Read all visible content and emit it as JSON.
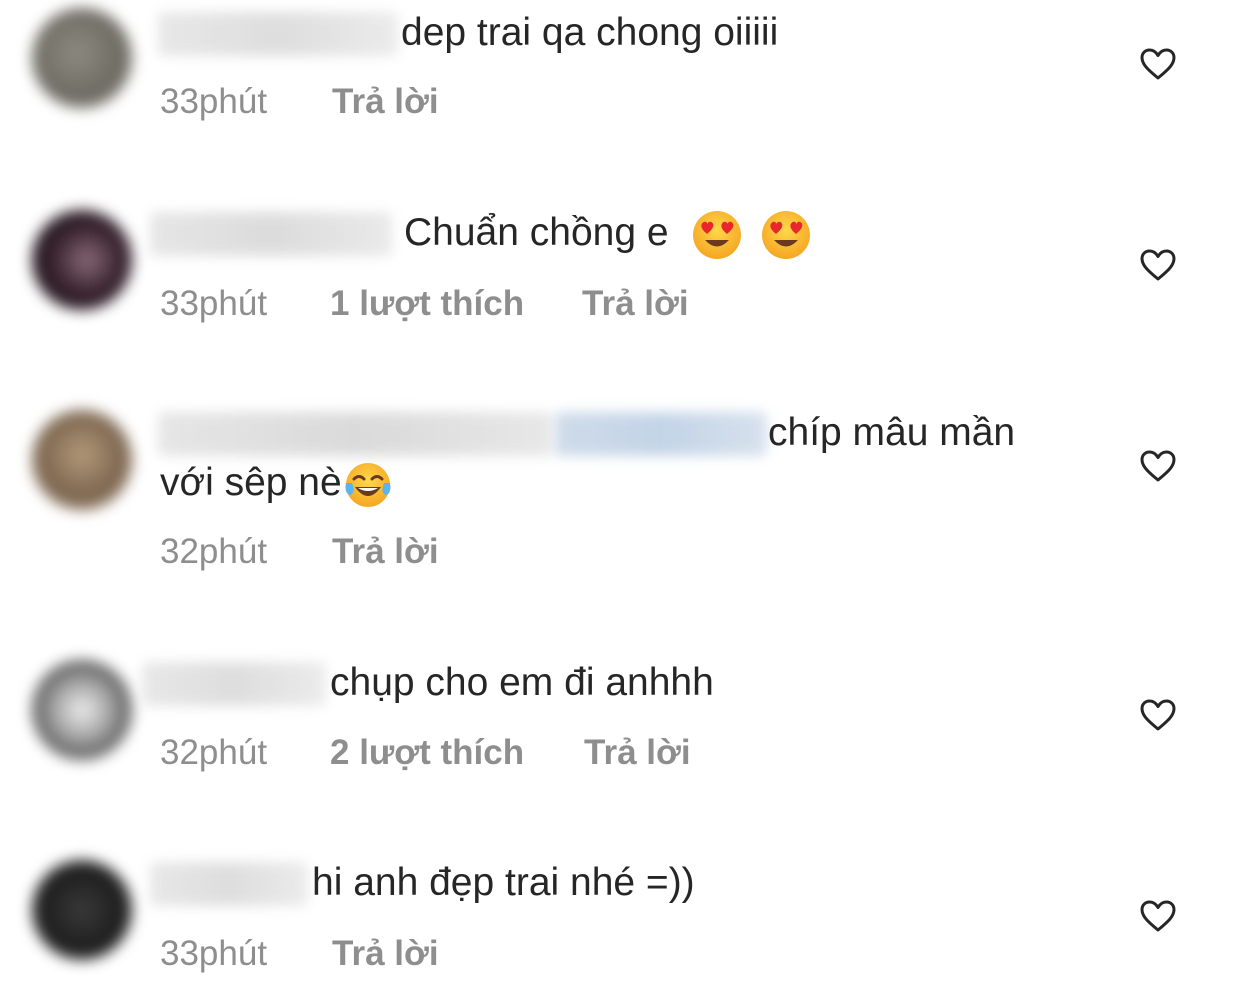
{
  "comments": [
    {
      "text": "dep trai qa chong oiiiii",
      "time": "33phút",
      "likes": "",
      "reply": "Trả lời"
    },
    {
      "text": "Chuẩn chồng e",
      "time": "33phút",
      "likes": "1 lượt thích",
      "reply": "Trả lời",
      "emojis": [
        "heart-eyes-emoji",
        "heart-eyes-emoji"
      ]
    },
    {
      "text": "chíp mâu mần",
      "text2": "với sêp nè",
      "time": "32phút",
      "likes": "",
      "reply": "Trả lời",
      "emojis": [
        "tears-of-joy-emoji"
      ]
    },
    {
      "text": "chụp cho em đi anhhh",
      "time": "32phút",
      "likes": "2 lượt thích",
      "reply": "Trả lời"
    },
    {
      "text": "hi anh đẹp trai nhé =))",
      "time": "33phút",
      "likes": "",
      "reply": "Trả lời"
    }
  ],
  "colors": {
    "text": "#262626",
    "meta": "#8e8e8e",
    "background": "#ffffff",
    "heart_outline": "#262626"
  },
  "icons": {
    "like": "heart-outline-icon"
  }
}
